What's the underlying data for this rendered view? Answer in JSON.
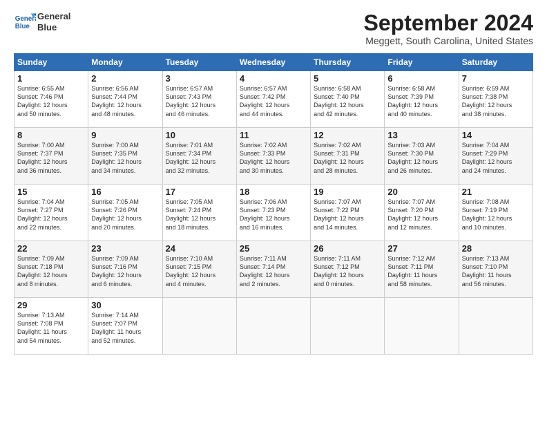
{
  "logo": {
    "line1": "General",
    "line2": "Blue"
  },
  "title": "September 2024",
  "location": "Meggett, South Carolina, United States",
  "days_of_week": [
    "Sunday",
    "Monday",
    "Tuesday",
    "Wednesday",
    "Thursday",
    "Friday",
    "Saturday"
  ],
  "weeks": [
    [
      {
        "day": "1",
        "info": "Sunrise: 6:55 AM\nSunset: 7:46 PM\nDaylight: 12 hours\nand 50 minutes."
      },
      {
        "day": "2",
        "info": "Sunrise: 6:56 AM\nSunset: 7:44 PM\nDaylight: 12 hours\nand 48 minutes."
      },
      {
        "day": "3",
        "info": "Sunrise: 6:57 AM\nSunset: 7:43 PM\nDaylight: 12 hours\nand 46 minutes."
      },
      {
        "day": "4",
        "info": "Sunrise: 6:57 AM\nSunset: 7:42 PM\nDaylight: 12 hours\nand 44 minutes."
      },
      {
        "day": "5",
        "info": "Sunrise: 6:58 AM\nSunset: 7:40 PM\nDaylight: 12 hours\nand 42 minutes."
      },
      {
        "day": "6",
        "info": "Sunrise: 6:58 AM\nSunset: 7:39 PM\nDaylight: 12 hours\nand 40 minutes."
      },
      {
        "day": "7",
        "info": "Sunrise: 6:59 AM\nSunset: 7:38 PM\nDaylight: 12 hours\nand 38 minutes."
      }
    ],
    [
      {
        "day": "8",
        "info": "Sunrise: 7:00 AM\nSunset: 7:37 PM\nDaylight: 12 hours\nand 36 minutes."
      },
      {
        "day": "9",
        "info": "Sunrise: 7:00 AM\nSunset: 7:35 PM\nDaylight: 12 hours\nand 34 minutes."
      },
      {
        "day": "10",
        "info": "Sunrise: 7:01 AM\nSunset: 7:34 PM\nDaylight: 12 hours\nand 32 minutes."
      },
      {
        "day": "11",
        "info": "Sunrise: 7:02 AM\nSunset: 7:33 PM\nDaylight: 12 hours\nand 30 minutes."
      },
      {
        "day": "12",
        "info": "Sunrise: 7:02 AM\nSunset: 7:31 PM\nDaylight: 12 hours\nand 28 minutes."
      },
      {
        "day": "13",
        "info": "Sunrise: 7:03 AM\nSunset: 7:30 PM\nDaylight: 12 hours\nand 26 minutes."
      },
      {
        "day": "14",
        "info": "Sunrise: 7:04 AM\nSunset: 7:29 PM\nDaylight: 12 hours\nand 24 minutes."
      }
    ],
    [
      {
        "day": "15",
        "info": "Sunrise: 7:04 AM\nSunset: 7:27 PM\nDaylight: 12 hours\nand 22 minutes."
      },
      {
        "day": "16",
        "info": "Sunrise: 7:05 AM\nSunset: 7:26 PM\nDaylight: 12 hours\nand 20 minutes."
      },
      {
        "day": "17",
        "info": "Sunrise: 7:05 AM\nSunset: 7:24 PM\nDaylight: 12 hours\nand 18 minutes."
      },
      {
        "day": "18",
        "info": "Sunrise: 7:06 AM\nSunset: 7:23 PM\nDaylight: 12 hours\nand 16 minutes."
      },
      {
        "day": "19",
        "info": "Sunrise: 7:07 AM\nSunset: 7:22 PM\nDaylight: 12 hours\nand 14 minutes."
      },
      {
        "day": "20",
        "info": "Sunrise: 7:07 AM\nSunset: 7:20 PM\nDaylight: 12 hours\nand 12 minutes."
      },
      {
        "day": "21",
        "info": "Sunrise: 7:08 AM\nSunset: 7:19 PM\nDaylight: 12 hours\nand 10 minutes."
      }
    ],
    [
      {
        "day": "22",
        "info": "Sunrise: 7:09 AM\nSunset: 7:18 PM\nDaylight: 12 hours\nand 8 minutes."
      },
      {
        "day": "23",
        "info": "Sunrise: 7:09 AM\nSunset: 7:16 PM\nDaylight: 12 hours\nand 6 minutes."
      },
      {
        "day": "24",
        "info": "Sunrise: 7:10 AM\nSunset: 7:15 PM\nDaylight: 12 hours\nand 4 minutes."
      },
      {
        "day": "25",
        "info": "Sunrise: 7:11 AM\nSunset: 7:14 PM\nDaylight: 12 hours\nand 2 minutes."
      },
      {
        "day": "26",
        "info": "Sunrise: 7:11 AM\nSunset: 7:12 PM\nDaylight: 12 hours\nand 0 minutes."
      },
      {
        "day": "27",
        "info": "Sunrise: 7:12 AM\nSunset: 7:11 PM\nDaylight: 11 hours\nand 58 minutes."
      },
      {
        "day": "28",
        "info": "Sunrise: 7:13 AM\nSunset: 7:10 PM\nDaylight: 11 hours\nand 56 minutes."
      }
    ],
    [
      {
        "day": "29",
        "info": "Sunrise: 7:13 AM\nSunset: 7:08 PM\nDaylight: 11 hours\nand 54 minutes."
      },
      {
        "day": "30",
        "info": "Sunrise: 7:14 AM\nSunset: 7:07 PM\nDaylight: 11 hours\nand 52 minutes."
      },
      {
        "day": "",
        "info": ""
      },
      {
        "day": "",
        "info": ""
      },
      {
        "day": "",
        "info": ""
      },
      {
        "day": "",
        "info": ""
      },
      {
        "day": "",
        "info": ""
      }
    ]
  ]
}
